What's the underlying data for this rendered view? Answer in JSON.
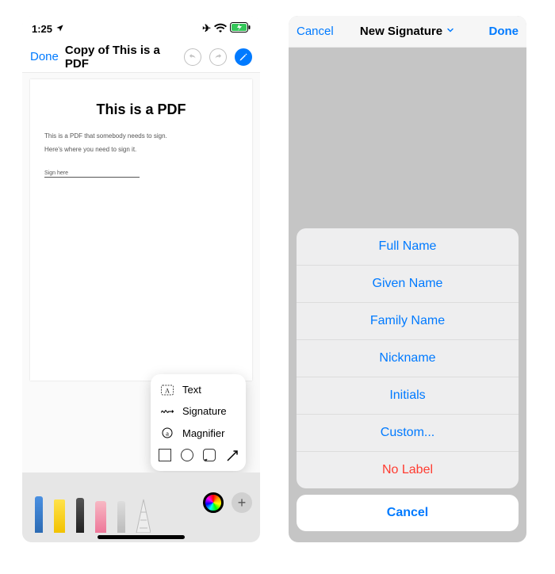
{
  "left": {
    "status": {
      "time": "1:25"
    },
    "nav": {
      "done": "Done",
      "title": "Copy of This is a PDF"
    },
    "doc": {
      "title": "This is a PDF",
      "line1": "This is a PDF that somebody needs to sign.",
      "line2": "Here's where you need to sign it.",
      "sign_label": "Sign here"
    },
    "popover": {
      "text": "Text",
      "signature": "Signature",
      "magnifier": "Magnifier"
    }
  },
  "right": {
    "nav": {
      "cancel": "Cancel",
      "title": "New Signature",
      "done": "Done"
    },
    "sheet": {
      "options": [
        "Full Name",
        "Given Name",
        "Family Name",
        "Nickname",
        "Initials",
        "Custom...",
        "No Label"
      ],
      "cancel": "Cancel"
    }
  }
}
